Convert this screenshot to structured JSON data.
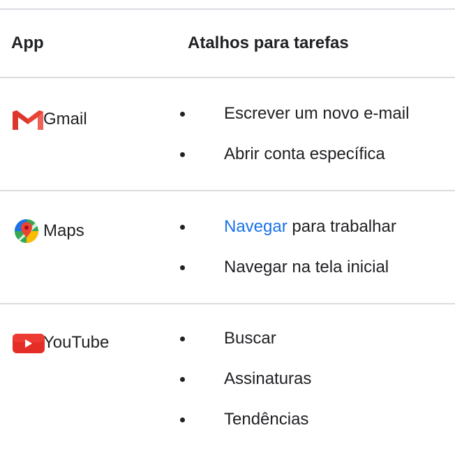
{
  "table": {
    "headers": {
      "app": "App",
      "tasks": "Atalhos para tarefas"
    },
    "rows": [
      {
        "app_name": "Gmail",
        "icon": "gmail-icon",
        "tasks": [
          "Escrever um novo e-mail",
          "Abrir conta específica"
        ]
      },
      {
        "app_name": "Maps",
        "icon": "maps-icon",
        "tasks_first_link": "Navegar",
        "tasks_first_rest": " para trabalhar",
        "tasks": [
          "Navegar na tela inicial"
        ]
      },
      {
        "app_name": "YouTube",
        "icon": "youtube-icon",
        "tasks": [
          "Buscar",
          "Assinaturas",
          "Tendências"
        ]
      }
    ]
  },
  "colors": {
    "text": "#202124",
    "link": "#1a73e8",
    "divider": "#dadce0",
    "gmail_red": "#ea4335",
    "youtube_red": "#e52d27"
  }
}
